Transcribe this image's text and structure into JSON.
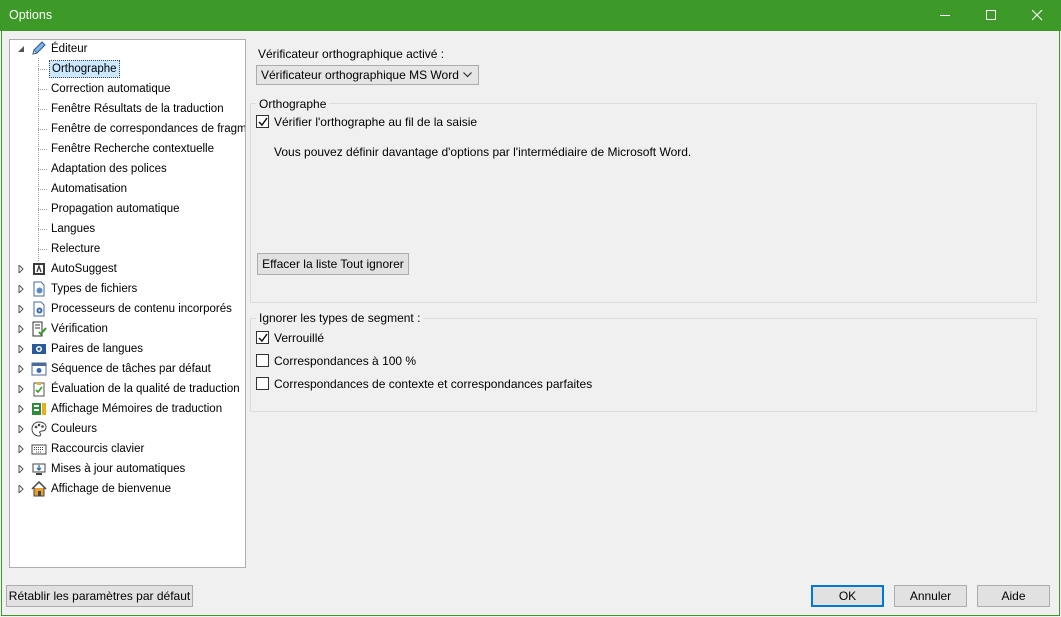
{
  "window": {
    "title": "Options"
  },
  "tree": {
    "editor": {
      "label": "Éditeur"
    },
    "editor_children": [
      {
        "label": "Orthographe"
      },
      {
        "label": "Correction automatique"
      },
      {
        "label": "Fenêtre Résultats de la traduction"
      },
      {
        "label": "Fenêtre de correspondances de fragm"
      },
      {
        "label": "Fenêtre Recherche contextuelle"
      },
      {
        "label": "Adaptation des polices"
      },
      {
        "label": "Automatisation"
      },
      {
        "label": "Propagation automatique"
      },
      {
        "label": "Langues"
      },
      {
        "label": "Relecture"
      }
    ],
    "top_nodes": [
      {
        "label": "AutoSuggest",
        "icon": "autosuggest-icon"
      },
      {
        "label": "Types de fichiers",
        "icon": "file-types-icon"
      },
      {
        "label": "Processeurs de contenu incorporés",
        "icon": "embedded-processors-icon"
      },
      {
        "label": "Vérification",
        "icon": "verification-icon"
      },
      {
        "label": "Paires de langues",
        "icon": "language-pairs-icon"
      },
      {
        "label": "Séquence de tâches par défaut",
        "icon": "task-sequence-icon"
      },
      {
        "label": "Évaluation de la qualité de traduction",
        "icon": "quality-evaluation-icon"
      },
      {
        "label": "Affichage Mémoires de traduction",
        "icon": "translation-memories-icon"
      },
      {
        "label": "Couleurs",
        "icon": "palette-icon"
      },
      {
        "label": "Raccourcis clavier",
        "icon": "keyboard-icon"
      },
      {
        "label": "Mises à jour automatiques",
        "icon": "auto-update-icon"
      },
      {
        "label": "Affichage de bienvenue",
        "icon": "home-icon"
      }
    ],
    "selected": "Orthographe"
  },
  "main": {
    "checker_label": "Vérificateur orthographique activé :",
    "checker_value": "Vérificateur orthographique MS Word",
    "spelling_group": {
      "title": "Orthographe",
      "check_as_you_type": {
        "label": "Vérifier l'orthographe au fil de la saisie",
        "checked": true
      },
      "note": "Vous pouvez définir davantage d'options par l'intermédiaire de Microsoft Word.",
      "clear_button": "Effacer la liste Tout ignorer"
    },
    "segments_group": {
      "title": "Ignorer les types de segment :",
      "options": [
        {
          "label": "Verrouillé",
          "checked": true
        },
        {
          "label": "Correspondances à 100 %",
          "checked": false
        },
        {
          "label": "Correspondances de contexte et correspondances parfaites",
          "checked": false
        }
      ]
    }
  },
  "footer": {
    "reset_label": "Rétablir les paramètres par défaut",
    "ok_label": "OK",
    "cancel_label": "Annuler",
    "help_label": "Aide"
  },
  "colors": {
    "titlebar": "#3d9a28",
    "selection": "#cce8ff",
    "default_button_border": "#0078d7"
  }
}
